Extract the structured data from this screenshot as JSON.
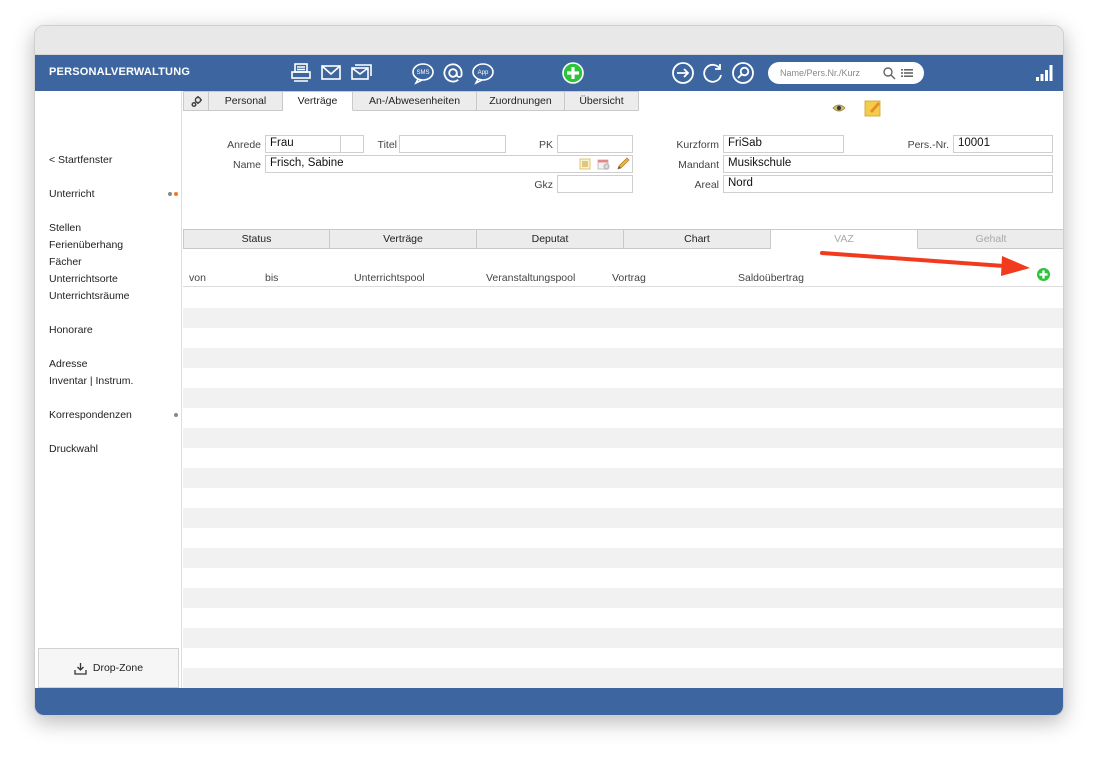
{
  "app": {
    "title": "PERSONALVERWALTUNG"
  },
  "search": {
    "placeholder": "Name/Pers.Nr./Kurz"
  },
  "sidebar": {
    "back": "< Startfenster",
    "items": [
      "Unterricht",
      "Stellen",
      "Ferienüberhang",
      "Fächer",
      "Unterrichtsorte",
      "Unterrichtsräume",
      "Honorare",
      "Adresse",
      "Inventar | Instrum.",
      "Korrespondenzen",
      "Druckwahl"
    ],
    "dropzone": "Drop-Zone"
  },
  "tabs_main": [
    "Personal",
    "Verträge",
    "An-/Abwesenheiten",
    "Zuordnungen",
    "Übersicht"
  ],
  "form": {
    "anrede_label": "Anrede",
    "anrede_value": "Frau",
    "titel_label": "Titel",
    "titel_value": "",
    "pk_label": "PK",
    "pk_value": "",
    "name_label": "Name",
    "name_value": "Frisch, Sabine",
    "gkz_label": "Gkz",
    "gkz_value": "",
    "kurzform_label": "Kurzform",
    "kurzform_value": "FriSab",
    "persnr_label": "Pers.-Nr.",
    "persnr_value": "10001",
    "mandant_label": "Mandant",
    "mandant_value": "Musikschule",
    "areal_label": "Areal",
    "areal_value": "Nord"
  },
  "tabs_sub": [
    "Status",
    "Verträge",
    "Deputat",
    "Chart",
    "VAZ",
    "Gehalt"
  ],
  "table": {
    "columns": [
      "von",
      "bis",
      "Unterrichtspool",
      "Veranstaltungspool",
      "Vortrag",
      "Saldoübertrag"
    ]
  },
  "colors": {
    "accent": "#3d66a0",
    "add": "#2ec43a",
    "arrow": "#f23a1e",
    "dot_orange": "#f07a22",
    "dot_gray": "#888888"
  }
}
